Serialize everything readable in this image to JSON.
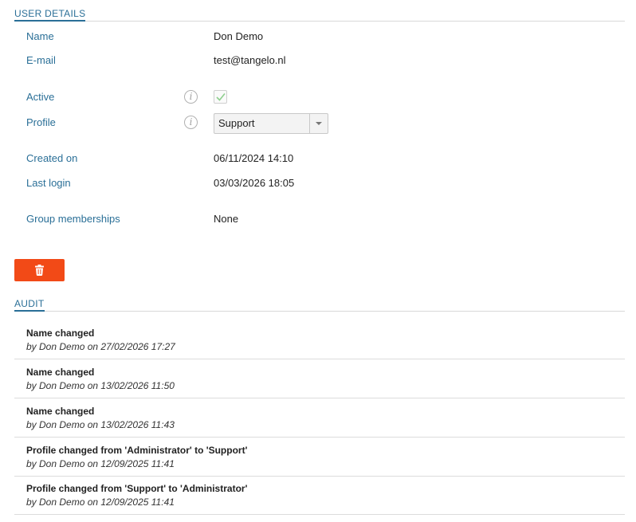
{
  "user_details": {
    "header": "USER DETAILS",
    "name_label": "Name",
    "name_value": "Don Demo",
    "email_label": "E-mail",
    "email_value": "test@tangelo.nl",
    "active_label": "Active",
    "active_checked": true,
    "profile_label": "Profile",
    "profile_value": "Support",
    "created_label": "Created on",
    "created_value": "06/11/2024 14:10",
    "last_login_label": "Last login",
    "last_login_value": "03/03/2026 18:05",
    "groups_label": "Group memberships",
    "groups_value": "None",
    "info_glyph": "i"
  },
  "delete_button": {
    "icon": "trash-icon",
    "color": "#f24a17"
  },
  "audit": {
    "header": "AUDIT",
    "items": [
      {
        "title": "Name changed",
        "meta": "by Don Demo on 27/02/2026 17:27"
      },
      {
        "title": "Name changed",
        "meta": "by Don Demo on 13/02/2026 11:50"
      },
      {
        "title": "Name changed",
        "meta": "by Don Demo on 13/02/2026 11:43"
      },
      {
        "title": "Profile changed from 'Administrator' to 'Support'",
        "meta": "by Don Demo on 12/09/2025 11:41"
      },
      {
        "title": "Profile changed from 'Support' to 'Administrator'",
        "meta": "by Don Demo on 12/09/2025 11:41"
      }
    ]
  },
  "colors": {
    "accent": "#2a6f97",
    "danger": "#f24a17",
    "check": "#8fcf8f"
  }
}
